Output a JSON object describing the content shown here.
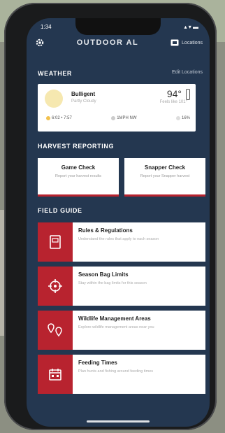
{
  "status": {
    "time": "1:34",
    "signal": "▴ ▾ ▬"
  },
  "app": {
    "title": "OUTDOOR AL",
    "locations_label": "Locations"
  },
  "weather": {
    "section_label": "WEATHER",
    "edit_label": "Edit Locations",
    "location": "Bulligent",
    "condition": "Partly Cloudy",
    "temperature": "94°",
    "feels_like": "Feels like 101°",
    "sun_times": "6:02 • 7:57",
    "wind": "1MPH NW",
    "moon": "16%"
  },
  "harvest": {
    "section_label": "HARVEST REPORTING",
    "cards": [
      {
        "title": "Game Check",
        "subtitle": "Report your harvest results"
      },
      {
        "title": "Snapper Check",
        "subtitle": "Report your Snapper harvest"
      }
    ]
  },
  "field_guide": {
    "section_label": "FIELD GUIDE",
    "items": [
      {
        "title": "Rules & Regulations",
        "subtitle": "Understand the rules that apply to each season",
        "icon": "book-icon"
      },
      {
        "title": "Season Bag Limits",
        "subtitle": "Stay within the bag limits for this season",
        "icon": "crosshair-icon"
      },
      {
        "title": "Wildlife Management Areas",
        "subtitle": "Explore wildlife management areas near you",
        "icon": "map-pin-icon"
      },
      {
        "title": "Feeding Times",
        "subtitle": "Plan hunts and fishing around feeding times",
        "icon": "calendar-icon"
      }
    ]
  },
  "colors": {
    "accent": "#b8232f",
    "background": "#243750",
    "card": "#ffffff"
  }
}
